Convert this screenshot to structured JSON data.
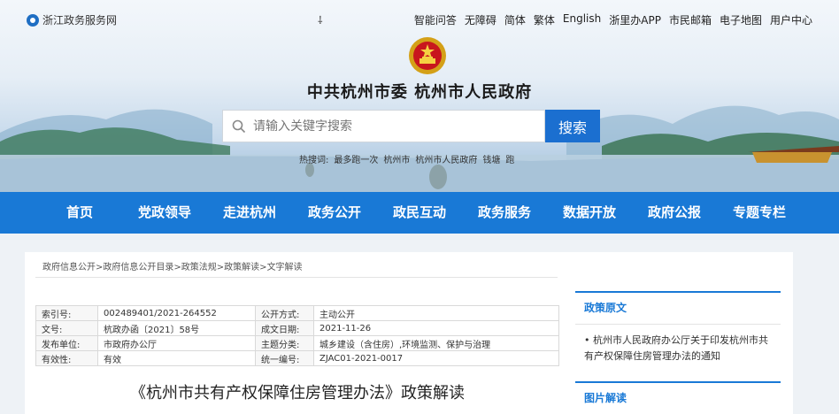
{
  "topbar": {
    "portal_name": "浙江政务服务网",
    "cursor_glyph": "⸸",
    "links": [
      "智能问答",
      "无障碍",
      "简体",
      "繁体",
      "English",
      "浙里办APP",
      "市民邮箱",
      "电子地图",
      "用户中心"
    ]
  },
  "header": {
    "title": "中共杭州市委  杭州市人民政府",
    "search_placeholder": "请输入关键字搜索",
    "search_button": "搜索",
    "hot_label": "热搜词:",
    "hot_words": [
      "最多跑一次",
      "杭州市",
      "杭州市人民政府",
      "钱塘",
      "跑"
    ]
  },
  "nav": [
    "首页",
    "党政领导",
    "走进杭州",
    "政务公开",
    "政民互动",
    "政务服务",
    "数据开放",
    "政府公报",
    "专题专栏"
  ],
  "breadcrumb": [
    "政府信息公开",
    "政府信息公开目录",
    "政策法规",
    "政策解读",
    "文字解读"
  ],
  "meta": {
    "rows": [
      {
        "l1": "索引号:",
        "v1": "002489401/2021-264552",
        "l2": "公开方式:",
        "v2": "主动公开"
      },
      {
        "l1": "文号:",
        "v1": "杭政办函〔2021〕58号",
        "l2": "成文日期:",
        "v2": "2021-11-26"
      },
      {
        "l1": "发布单位:",
        "v1": "市政府办公厅",
        "l2": "主题分类:",
        "v2": "城乡建设（含住房）,环境监测、保护与治理"
      },
      {
        "l1": "有效性:",
        "v1": "有效",
        "l2": "统一编号:",
        "v2": "ZJAC01-2021-0017"
      }
    ]
  },
  "document": {
    "title": "《杭州市共有产权保障住房管理办法》政策解读"
  },
  "side": {
    "policy_heading": "政策原文",
    "policy_link": "• 杭州市人民政府办公厅关于印发杭州市共有产权保障住房管理办法的通知",
    "image_heading": "图片解读"
  },
  "colors": {
    "nav": "#1979d6",
    "search_button": "#1b6fd0",
    "side_heading": "#1979d6"
  }
}
